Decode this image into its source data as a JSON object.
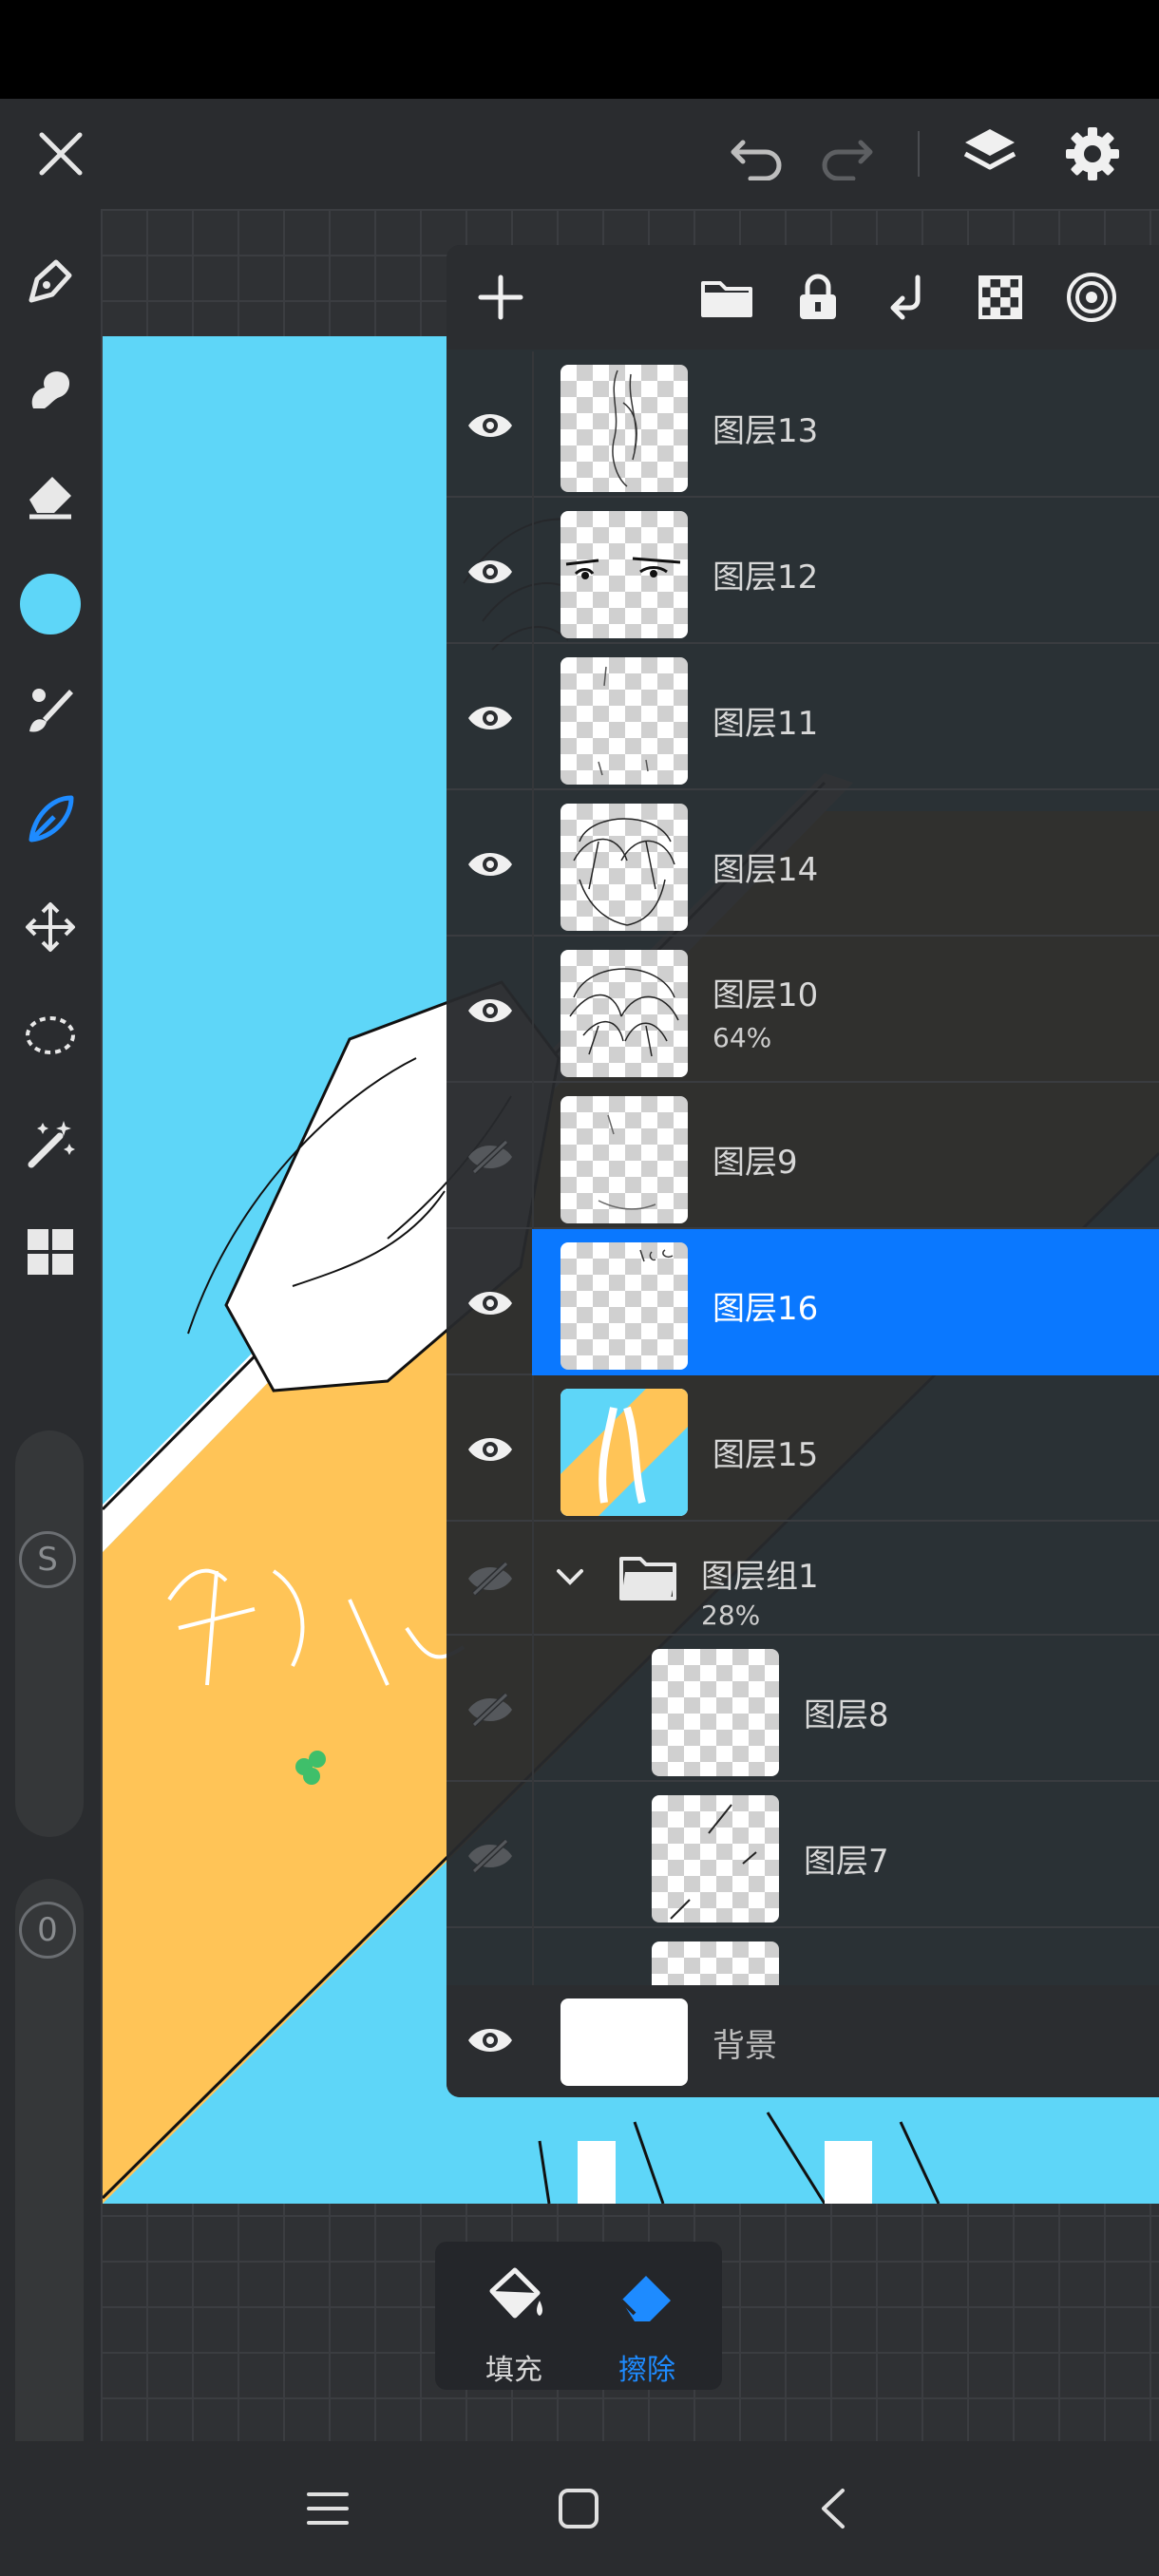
{
  "colors": {
    "accent": "#0a78ff",
    "canvas_cyan": "#5ed6f8",
    "canvas_orange": "#ffc457",
    "active_tool": "#1e8bff",
    "current_color": "#5ed6f8"
  },
  "topbar": {
    "icons": [
      "close-icon",
      "undo-icon",
      "redo-icon",
      "layers-icon",
      "gear-icon"
    ]
  },
  "left_toolbar": {
    "tools": [
      "pen-icon",
      "smudge-icon",
      "eraser-icon",
      "color-swatch",
      "brush-icon",
      "lasso-fill-icon",
      "move-icon",
      "selection-icon",
      "magic-wand-icon",
      "grid-icon"
    ],
    "size_slider_label": "S",
    "opacity_slider_label": "0"
  },
  "layers_panel": {
    "toolbar_icons": [
      "add-icon",
      "folder-icon",
      "lock-icon",
      "merge-down-icon",
      "transparency-icon",
      "target-icon"
    ],
    "layers": [
      {
        "name": "图层13",
        "opacity": "",
        "visible": true
      },
      {
        "name": "图层12",
        "opacity": "",
        "visible": true
      },
      {
        "name": "图层11",
        "opacity": "",
        "visible": true
      },
      {
        "name": "图层14",
        "opacity": "",
        "visible": true
      },
      {
        "name": "图层10",
        "opacity": "64%",
        "visible": true
      },
      {
        "name": "图层9",
        "opacity": "",
        "visible": false
      },
      {
        "name": "图层16",
        "opacity": "",
        "visible": true,
        "selected": true
      },
      {
        "name": "图层15",
        "opacity": "",
        "visible": true
      }
    ],
    "group": {
      "name": "图层组1",
      "opacity": "28%",
      "visible": false
    },
    "group_layers": [
      {
        "name": "图层8",
        "visible": false
      },
      {
        "name": "图层7",
        "visible": false
      }
    ],
    "background": {
      "name": "背景",
      "visible": true
    }
  },
  "bottom_tools": {
    "fill_label": "填充",
    "erase_label": "擦除",
    "active": "erase"
  },
  "navbar": {
    "icons": [
      "menu-icon",
      "home-icon",
      "back-icon"
    ]
  }
}
